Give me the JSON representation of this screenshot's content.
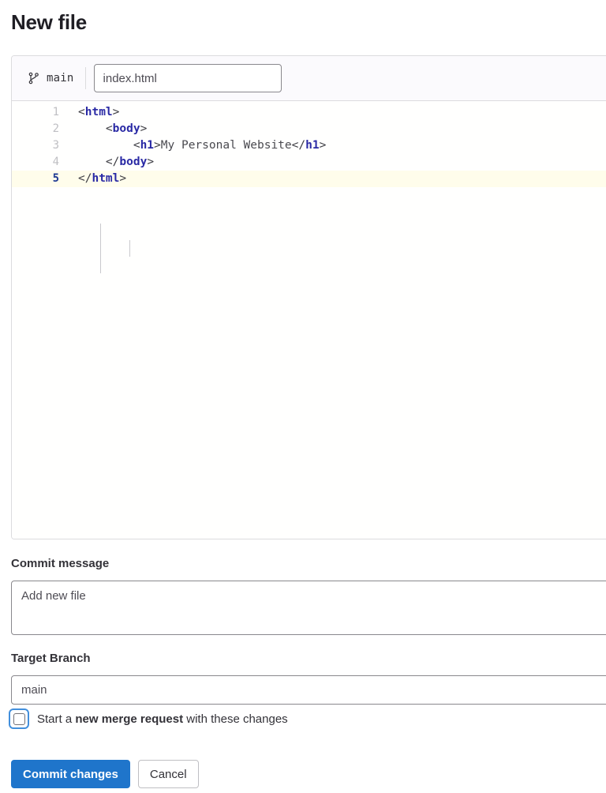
{
  "page": {
    "title": "New file"
  },
  "editor": {
    "branch_icon": "branch-icon",
    "branch_name": "main",
    "filename_value": "index.html",
    "filename_placeholder": "File name",
    "active_line": 5,
    "lines": [
      {
        "number": "1",
        "tokens": [
          {
            "t": "punct",
            "v": "<"
          },
          {
            "t": "tag",
            "v": "html"
          },
          {
            "t": "punct",
            "v": ">"
          }
        ]
      },
      {
        "number": "2",
        "tokens": [
          {
            "t": "punct",
            "v": "    <"
          },
          {
            "t": "tag",
            "v": "body"
          },
          {
            "t": "punct",
            "v": ">"
          }
        ]
      },
      {
        "number": "3",
        "tokens": [
          {
            "t": "punct",
            "v": "        <"
          },
          {
            "t": "tag",
            "v": "h1"
          },
          {
            "t": "punct",
            "v": ">"
          },
          {
            "t": "text",
            "v": "My Personal Website"
          },
          {
            "t": "punct",
            "v": "</"
          },
          {
            "t": "tag",
            "v": "h1"
          },
          {
            "t": "punct",
            "v": ">"
          }
        ]
      },
      {
        "number": "4",
        "tokens": [
          {
            "t": "punct",
            "v": "    </"
          },
          {
            "t": "tag",
            "v": "body"
          },
          {
            "t": "punct",
            "v": ">"
          }
        ]
      },
      {
        "number": "5",
        "tokens": [
          {
            "t": "punct",
            "v": "</"
          },
          {
            "t": "tag",
            "v": "html"
          },
          {
            "t": "punct",
            "v": ">"
          }
        ]
      }
    ]
  },
  "form": {
    "commit_message_label": "Commit message",
    "commit_message_value": "Add new file",
    "commit_message_placeholder": "Add new file",
    "target_branch_label": "Target Branch",
    "target_branch_value": "main",
    "target_branch_placeholder": "main",
    "merge_request_checkbox": {
      "checked": false,
      "text_before": "Start a ",
      "text_strong": "new merge request",
      "text_after": " with these changes"
    }
  },
  "buttons": {
    "commit_label": "Commit changes",
    "cancel_label": "Cancel"
  },
  "colors": {
    "primary": "#1f75cb",
    "focus_ring": "#428fdc",
    "active_line_bg": "#fffdeb",
    "tag": "#2a2aa5",
    "header_bg": "#fbfafd"
  }
}
